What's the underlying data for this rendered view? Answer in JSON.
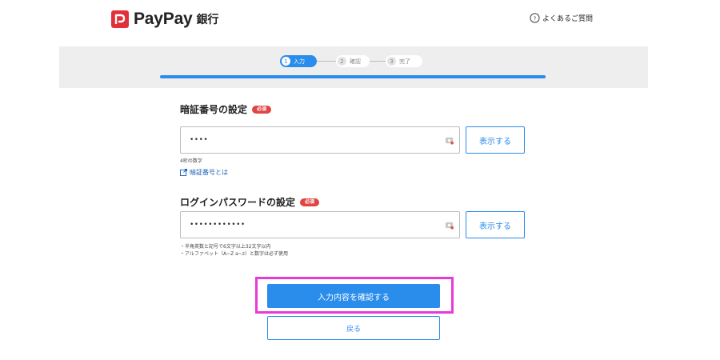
{
  "header": {
    "logo_text": "PayPay",
    "logo_sub": "銀行",
    "faq_label": "よくあるご質問",
    "brand_color": "#e0303a"
  },
  "stepper": {
    "steps": [
      {
        "num": "1",
        "label": "入力",
        "state": "active"
      },
      {
        "num": "2",
        "label": "確認",
        "state": "inactive"
      },
      {
        "num": "3",
        "label": "完了",
        "state": "inactive"
      }
    ],
    "progress_color": "#2a8ceb"
  },
  "pin_section": {
    "title": "暗証番号の設定",
    "required_badge": "必須",
    "value": "••••",
    "show_button": "表示する",
    "hint": "4桁の数字",
    "help_link": "暗証番号とは"
  },
  "password_section": {
    "title": "ログインパスワードの設定",
    "required_badge": "必須",
    "value": "••••••••••••",
    "show_button": "表示する",
    "hints": [
      "・半角英数と記号で6文字以上32文字以内",
      "・アルファベット（A~Z a~z）と数字は必ず使用"
    ]
  },
  "actions": {
    "confirm_label": "入力内容を確認する",
    "back_label": "戻る",
    "highlight_color": "#e83ad8"
  }
}
